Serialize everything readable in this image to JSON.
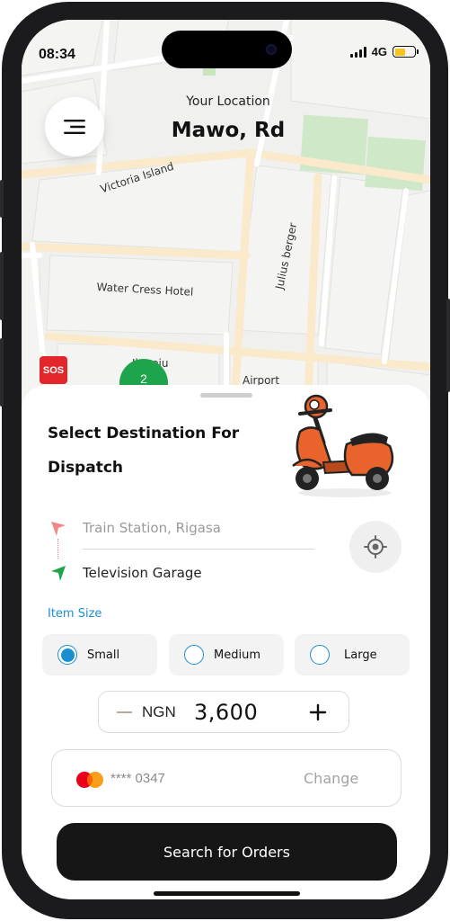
{
  "status_bar": {
    "time": "08:34",
    "network": "4G"
  },
  "map": {
    "your_location_label": "Your Location",
    "location_name": "Mawo, Rd",
    "labels": {
      "victoria_island": "Victoria Island",
      "julius_berger": "Julius berger",
      "water_cress_hotel": "Water Cress Hotel",
      "ilupeju": "Ilupeju",
      "airport": "Airport"
    },
    "sos_label": "SOS",
    "cluster_count": "2"
  },
  "sheet": {
    "title": "Select Destination For Dispatch",
    "route": {
      "from": "Train Station, Rigasa",
      "to": "Television Garage"
    },
    "item_size": {
      "label": "Item Size",
      "options": [
        "Small",
        "Medium",
        "Large"
      ],
      "selected": "Small"
    },
    "price": {
      "currency": "NGN",
      "amount": "3,600"
    },
    "payment": {
      "card_number": "**** 0347",
      "change_label": "Change"
    },
    "cta_label": "Search for Orders"
  },
  "colors": {
    "accent": "#1a8fd0",
    "sos": "#e3262b",
    "cluster": "#1ea44b",
    "button": "#161616"
  }
}
